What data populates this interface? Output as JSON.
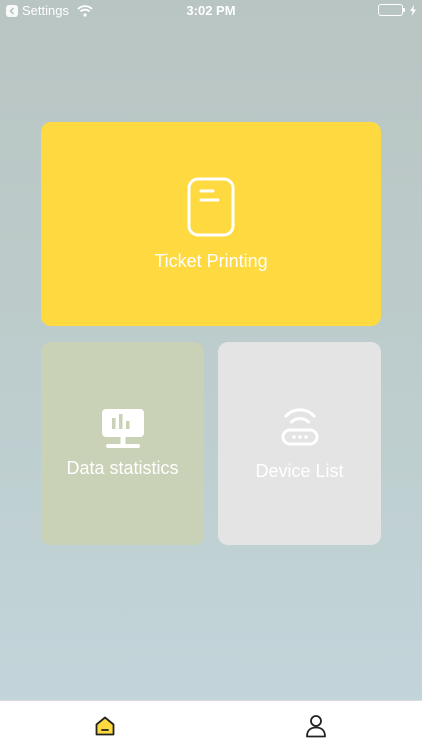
{
  "status_bar": {
    "back_app": "Settings",
    "time": "3:02 PM"
  },
  "tiles": {
    "ticket_printing": {
      "label": "Ticket Printing",
      "color": "#fed93f",
      "icon": "receipt-icon"
    },
    "data_statistics": {
      "label": "Data statistics",
      "color": "#c9d1b6",
      "icon": "monitor-chart-icon"
    },
    "device_list": {
      "label": "Device List",
      "color": "#e4e4e4",
      "icon": "router-icon"
    }
  },
  "tab_bar": {
    "items": [
      {
        "icon": "home-icon",
        "active": true,
        "color": "#fed93f"
      },
      {
        "icon": "person-icon",
        "active": false
      }
    ]
  }
}
